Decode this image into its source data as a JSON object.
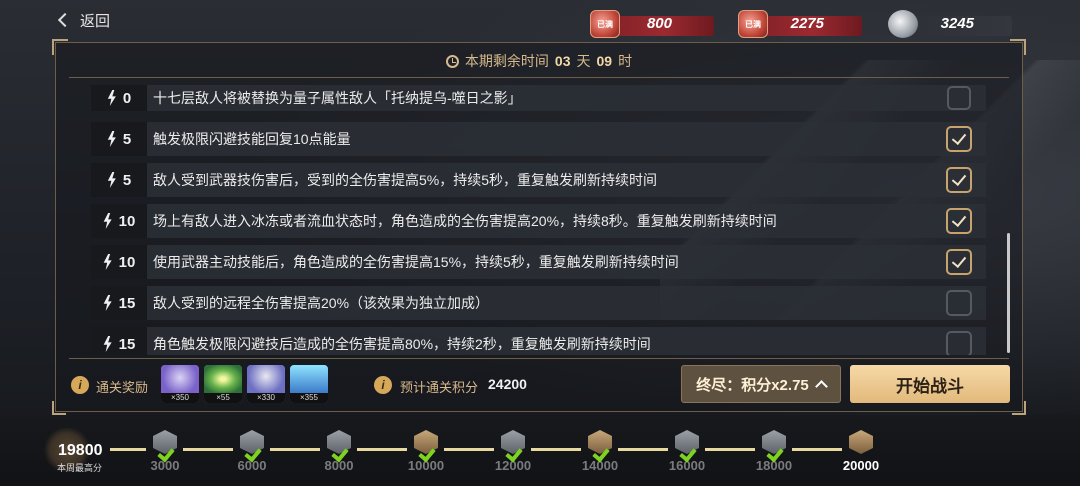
{
  "top": {
    "back_label": "返回",
    "currencies": [
      {
        "name": "currency-red-1",
        "icon": "red-ticket-icon",
        "badge": "已满",
        "value": "800"
      },
      {
        "name": "currency-red-2",
        "icon": "red-gem-icon",
        "badge": "已满",
        "value": "2275"
      },
      {
        "name": "currency-silver",
        "icon": "silver-badge-icon",
        "value": "3245"
      }
    ]
  },
  "timer": {
    "prefix": "本期剩余时间",
    "days": "03",
    "days_unit": "天",
    "hours": "09",
    "hours_unit": "时"
  },
  "modifiers": [
    {
      "cost": "0",
      "text": "十七层敌人将被替换为量子属性敌人「托纳提乌-噬日之影」",
      "checked": false
    },
    {
      "cost": "5",
      "text": "触发极限闪避技能回复10点能量",
      "checked": true
    },
    {
      "cost": "5",
      "text": "敌人受到武器技伤害后，受到的全伤害提高5%，持续5秒，重复触发刷新持续时间",
      "checked": true
    },
    {
      "cost": "10",
      "text": "场上有敌人进入冰冻或者流血状态时，角色造成的全伤害提高20%，持续8秒。重复触发刷新持续时间",
      "checked": true
    },
    {
      "cost": "10",
      "text": "使用武器主动技能后，角色造成的全伤害提高15%，持续5秒，重复触发刷新持续时间",
      "checked": true
    },
    {
      "cost": "15",
      "text": "敌人受到的远程全伤害提高20%（该效果为独立加成）",
      "checked": false
    },
    {
      "cost": "15",
      "text": "角色触发极限闪避技后造成的全伤害提高80%，持续2秒，重复触发刷新持续时间",
      "checked": false
    }
  ],
  "bottom": {
    "reward_label": "通关奖励",
    "rewards": [
      {
        "count": "×350",
        "color": "#7a62c9"
      },
      {
        "count": "×55",
        "color": "#67b34a"
      },
      {
        "count": "×330",
        "color": "#6d6fc2"
      },
      {
        "count": "×355",
        "color": "#3b7bc9"
      }
    ],
    "score_label": "预计通关积分",
    "score_value": "24200",
    "mode_label": "终尽：积分x2.75",
    "start_label": "开始战斗"
  },
  "progress": {
    "best_value": "19800",
    "best_label": "本周最高分",
    "nodes": [
      {
        "value": "3000",
        "claimed": true,
        "gold": false
      },
      {
        "value": "6000",
        "claimed": true,
        "gold": false
      },
      {
        "value": "8000",
        "claimed": true,
        "gold": false
      },
      {
        "value": "10000",
        "claimed": true,
        "gold": true
      },
      {
        "value": "12000",
        "claimed": true,
        "gold": false
      },
      {
        "value": "14000",
        "claimed": true,
        "gold": true
      },
      {
        "value": "16000",
        "claimed": true,
        "gold": false
      },
      {
        "value": "18000",
        "claimed": true,
        "gold": false
      },
      {
        "value": "20000",
        "claimed": false,
        "gold": true
      }
    ]
  }
}
